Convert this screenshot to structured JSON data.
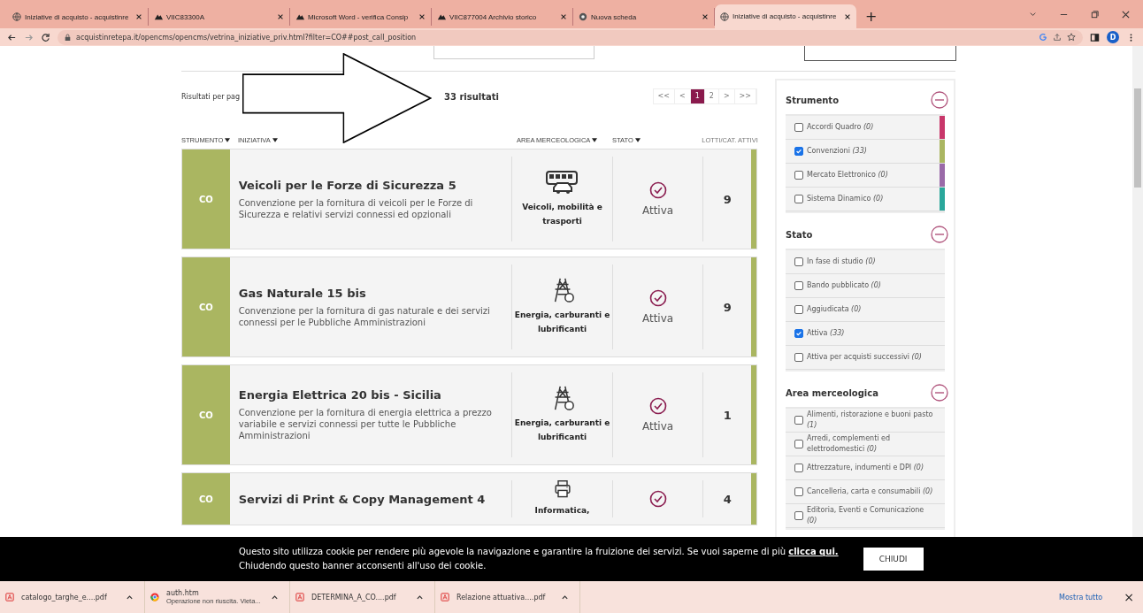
{
  "browser": {
    "tabs": [
      {
        "title": "Iniziative di acquisto - acquistinre",
        "kind": "globe",
        "selected": false
      },
      {
        "title": "VIIC83300A",
        "kind": "cloud",
        "selected": false
      },
      {
        "title": "Microsoft Word - verifica Consip",
        "kind": "cloud",
        "selected": false
      },
      {
        "title": "VIIC877004 Archivio storico",
        "kind": "cloud",
        "selected": false
      },
      {
        "title": "Nuova scheda",
        "kind": "chrome",
        "selected": false
      },
      {
        "title": "Iniziative di acquisto - acquistinre",
        "kind": "globe",
        "selected": true
      }
    ],
    "new_tab": "+",
    "url": "acquistinretepa.it/opencms/opencms/vetrina_iniziative_priv.html?filter=CO##post_call_position",
    "profile": "D"
  },
  "results": {
    "per_page_label": "Risultati per pag",
    "count": "33 risultati",
    "pagination": [
      {
        "label": "<<",
        "selected": false
      },
      {
        "label": "<",
        "selected": false
      },
      {
        "label": "1",
        "selected": true
      },
      {
        "label": "2",
        "selected": false
      },
      {
        "label": ">",
        "selected": false
      },
      {
        "label": ">>",
        "selected": false
      }
    ]
  },
  "table": {
    "columns": [
      {
        "label": "STRUMENTO",
        "sortable": true
      },
      {
        "label": "INIZIATIVA",
        "sortable": true
      },
      {
        "label": "AREA MERCEOLOGICA",
        "sortable": true
      },
      {
        "label": "STATO",
        "sortable": true
      },
      {
        "label": "LOTTI/CAT. ATTIVI",
        "sortable": false
      }
    ],
    "rows": [
      {
        "code": "CO",
        "title": "Veicoli per le Forze di Sicurezza 5",
        "description": "Convenzione per la fornitura di veicoli per le Forze di Sicurezza e relativi servizi connessi ed opzionali",
        "kind": "vehicles",
        "area": "Veicoli, mobilità e trasporti",
        "status": "Attiva",
        "lots": "9",
        "color": "#aab661"
      },
      {
        "code": "CO",
        "title": "Gas Naturale 15 bis",
        "description": "Convenzione per la fornitura di gas naturale e dei servizi connessi per le Pubbliche Amministrazioni",
        "kind": "energy",
        "area": "Energia, carburanti e lubrificanti",
        "status": "Attiva",
        "lots": "9",
        "color": "#aab661"
      },
      {
        "code": "CO",
        "title": "Energia Elettrica 20 bis - Sicilia",
        "description": "Convenzione per la fornitura di energia elettrica a prezzo variabile e servizi connessi per tutte le Pubbliche Amministrazioni",
        "kind": "energy",
        "area": "Energia, carburanti e lubrificanti",
        "status": "Attiva",
        "lots": "1",
        "color": "#aab661"
      },
      {
        "code": "CO",
        "title": "Servizi di Print & Copy Management 4",
        "kind": "printer",
        "area": "Informatica,",
        "lots": "4",
        "color": "#aab661"
      }
    ]
  },
  "filters": [
    {
      "title": "Strumento",
      "items": [
        {
          "label": "Accordi Quadro *(0)*",
          "checked": false,
          "color": "#c8376a"
        },
        {
          "label": "Convenzioni *(33)*",
          "checked": true,
          "color": "#aab661"
        },
        {
          "label": "Mercato Elettronico *(0)*",
          "checked": false,
          "color": "#9a6aa8"
        },
        {
          "label": "Sistema Dinamico *(0)*",
          "checked": false,
          "color": "#2aa79b"
        }
      ]
    },
    {
      "title": "Stato",
      "items": [
        {
          "label": "In fase di studio *(0)*",
          "checked": false
        },
        {
          "label": "Bando pubblicato *(0)*",
          "checked": false
        },
        {
          "label": "Aggiudicata *(0)*",
          "checked": false
        },
        {
          "label": "Attiva *(33)*",
          "checked": true
        },
        {
          "label": "Attiva per acquisti successivi *(0)*",
          "checked": false
        }
      ]
    },
    {
      "title": "Area merceologica",
      "items": [
        {
          "label": "Alimenti, ristorazione e buoni pasto *(1)*",
          "checked": false
        },
        {
          "label": "Arredi, complementi ed elettrodomestici *(0)*",
          "checked": false
        },
        {
          "label": "Attrezzature, indumenti e DPI *(0)*",
          "checked": false
        },
        {
          "label": "Cancelleria, carta e consumabili *(0)*",
          "checked": false
        },
        {
          "label": "Editoria, Eventi e Comunicazione *(0)*",
          "checked": false
        }
      ]
    }
  ],
  "cookie_banner": {
    "text": "Questo sito utilizza cookie per rendere più agevole la navigazione e garantire la fruizione dei servizi. Se vuoi saperne di più ",
    "link": "clicca qui.",
    "text_2": "Chiudendo questo banner acconsenti all'uso dei cookie.",
    "button": "CHIUDI"
  },
  "downloads": {
    "items": [
      {
        "name": "catalogo_targhe_e....pdf",
        "kind": "pdf"
      },
      {
        "name": "auth.htm",
        "status": "Operazione non riuscita. Vieta...",
        "kind": "chrome"
      },
      {
        "name": "DETERMINA_A_CO....pdf",
        "kind": "pdf"
      },
      {
        "name": "Relazione attuativa....pdf",
        "kind": "pdf"
      }
    ],
    "show_all": "Mostra tutto",
    "close": "×"
  }
}
